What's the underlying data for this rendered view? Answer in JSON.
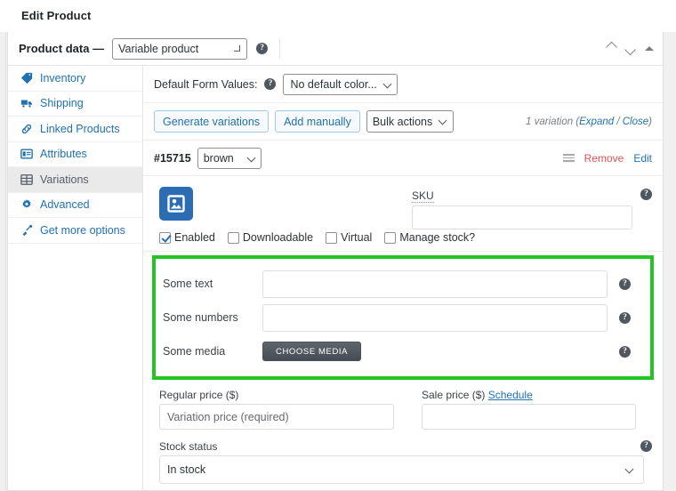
{
  "topbar": {
    "title": "Edit Product"
  },
  "metabox": {
    "header_label": "Product data —",
    "product_type": "Variable product",
    "help": "?",
    "order_up": "order-up",
    "order_down": "order-down",
    "toggle": "toggle-panel"
  },
  "tabs": [
    {
      "label": "Inventory",
      "icon": "inventory-icon",
      "active": false
    },
    {
      "label": "Shipping",
      "icon": "shipping-truck-icon",
      "active": false
    },
    {
      "label": "Linked Products",
      "icon": "link-icon",
      "active": false
    },
    {
      "label": "Attributes",
      "icon": "attributes-icon",
      "active": false
    },
    {
      "label": "Variations",
      "icon": "grid-icon",
      "active": true
    },
    {
      "label": "Advanced",
      "icon": "gear-icon",
      "active": false
    },
    {
      "label": "Get more options",
      "icon": "extension-icon",
      "active": false
    }
  ],
  "default_form_values": {
    "label": "Default Form Values:",
    "selected": "No default color..."
  },
  "toolbar": {
    "generate_variations": "Generate variations",
    "add_manually": "Add manually",
    "bulk_actions": "Bulk actions",
    "count_text": "1 variation (",
    "expand": "Expand",
    "separator": " / ",
    "close": "Close",
    "count_end": ")"
  },
  "variation": {
    "id": "#15715",
    "attribute_value": "brown",
    "remove": "Remove",
    "edit": "Edit",
    "sku_label": "SKU",
    "sku_value": "",
    "checkboxes": [
      {
        "label": "Enabled",
        "checked": true
      },
      {
        "label": "Downloadable",
        "checked": false
      },
      {
        "label": "Virtual",
        "checked": false
      },
      {
        "label": "Manage stock?",
        "checked": false
      }
    ]
  },
  "custom_fields": {
    "highlight_color": "#22c522",
    "rows": [
      {
        "label": "Some text",
        "type": "text",
        "value": ""
      },
      {
        "label": "Some numbers",
        "type": "text",
        "value": ""
      },
      {
        "label": "Some media",
        "type": "button",
        "button_label": "CHOOSE MEDIA"
      }
    ]
  },
  "pricing": {
    "regular_label": "Regular price ($)",
    "regular_placeholder": "Variation price (required)",
    "sale_label": "Sale price ($)",
    "schedule_label": "Schedule",
    "sale_value": "",
    "stock_label": "Stock status",
    "stock_value": "In stock"
  }
}
